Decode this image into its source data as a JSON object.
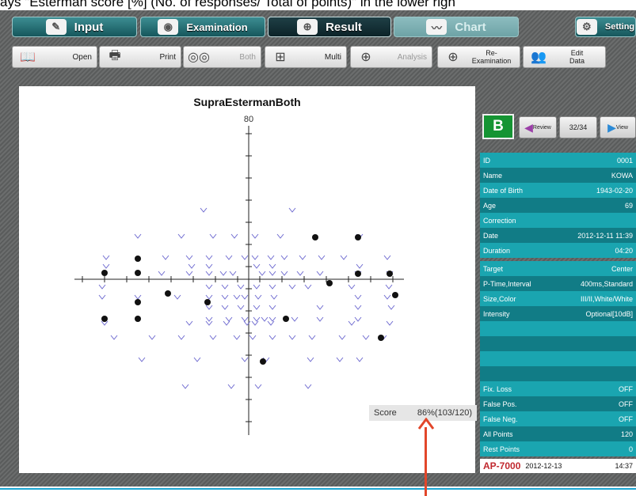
{
  "caption": "ays \"Esterman score [%] (No. of responses/ Total of points)\" in the lower righ",
  "tabs": [
    {
      "label": "Input",
      "icon": "pen-icon"
    },
    {
      "label": "Examination",
      "icon": "eye-target-icon"
    },
    {
      "label": "Result",
      "icon": "grid-icon"
    },
    {
      "label": "Chart",
      "icon": "chart-icon"
    },
    {
      "label": "Setting",
      "icon": "gear-icon"
    }
  ],
  "toolbar": {
    "open": "Open",
    "print": "Print",
    "both": "Both",
    "multi": "Multi",
    "analysis": "Analysis",
    "reexam": "Re-\nExamination",
    "edit": "Edit\nData"
  },
  "plot": {
    "title": "SupraEstermanBoth",
    "axis_top_label": "80",
    "score_label": "Score",
    "score_value": "86%(103/120)"
  },
  "panel": {
    "badge": "B",
    "nav_prev": "Review",
    "nav_count": "32/34",
    "nav_next": "View",
    "info": [
      {
        "k": "ID",
        "v": "0001"
      },
      {
        "k": "Name",
        "v": "KOWA"
      },
      {
        "k": "Date of Birth",
        "v": "1943-02-20"
      },
      {
        "k": "Age",
        "v": "69"
      },
      {
        "k": "Correction",
        "v": ""
      },
      {
        "k": "Date",
        "v": "2012-12-11 11:39"
      },
      {
        "k": "Duration",
        "v": "04:20"
      }
    ],
    "params": [
      {
        "k": "Target",
        "v": "Center"
      },
      {
        "k": "P-Time,Interval",
        "v": "400ms,Standard"
      },
      {
        "k": "Size,Color",
        "v": "III/II,White/White"
      },
      {
        "k": "Intensity",
        "v": "Optional[10dB]"
      }
    ],
    "reliability": [
      {
        "k": "Fix. Loss",
        "v": "OFF"
      },
      {
        "k": "False Pos.",
        "v": "OFF"
      },
      {
        "k": "False Neg.",
        "v": "OFF"
      },
      {
        "k": "All Points",
        "v": "120"
      },
      {
        "k": "Rest Points",
        "v": "0"
      }
    ],
    "footer_model": "AP-7000",
    "footer_date": "2012-12-13",
    "footer_time": "14:37"
  },
  "colors": {
    "teal": "#1aa5b0",
    "dark_teal": "#117c86",
    "seen_mark": "#6e6ad0",
    "badge_green": "#159433",
    "arrow": "#e2462a"
  }
}
